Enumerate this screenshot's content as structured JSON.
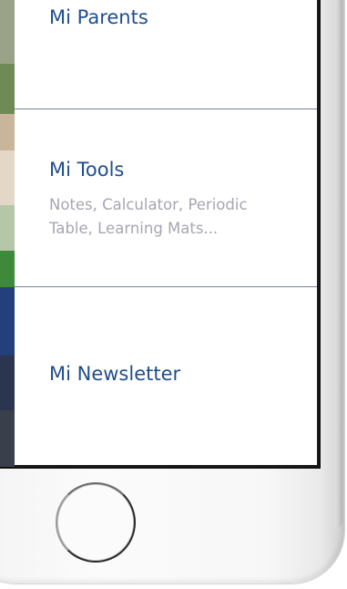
{
  "menu": {
    "items": [
      {
        "title": "Mi Parents"
      },
      {
        "title": "Mi Tools",
        "subtitle": "Notes, Calculator, Periodic Table, Learning Mats..."
      },
      {
        "title": "Mi Newsletter"
      }
    ]
  },
  "colors": {
    "title": "#1f4e8c",
    "subtitle": "#a6a6b2",
    "divider": "#7a7f96"
  },
  "device": {
    "home_button_icon": "home-button-icon"
  }
}
